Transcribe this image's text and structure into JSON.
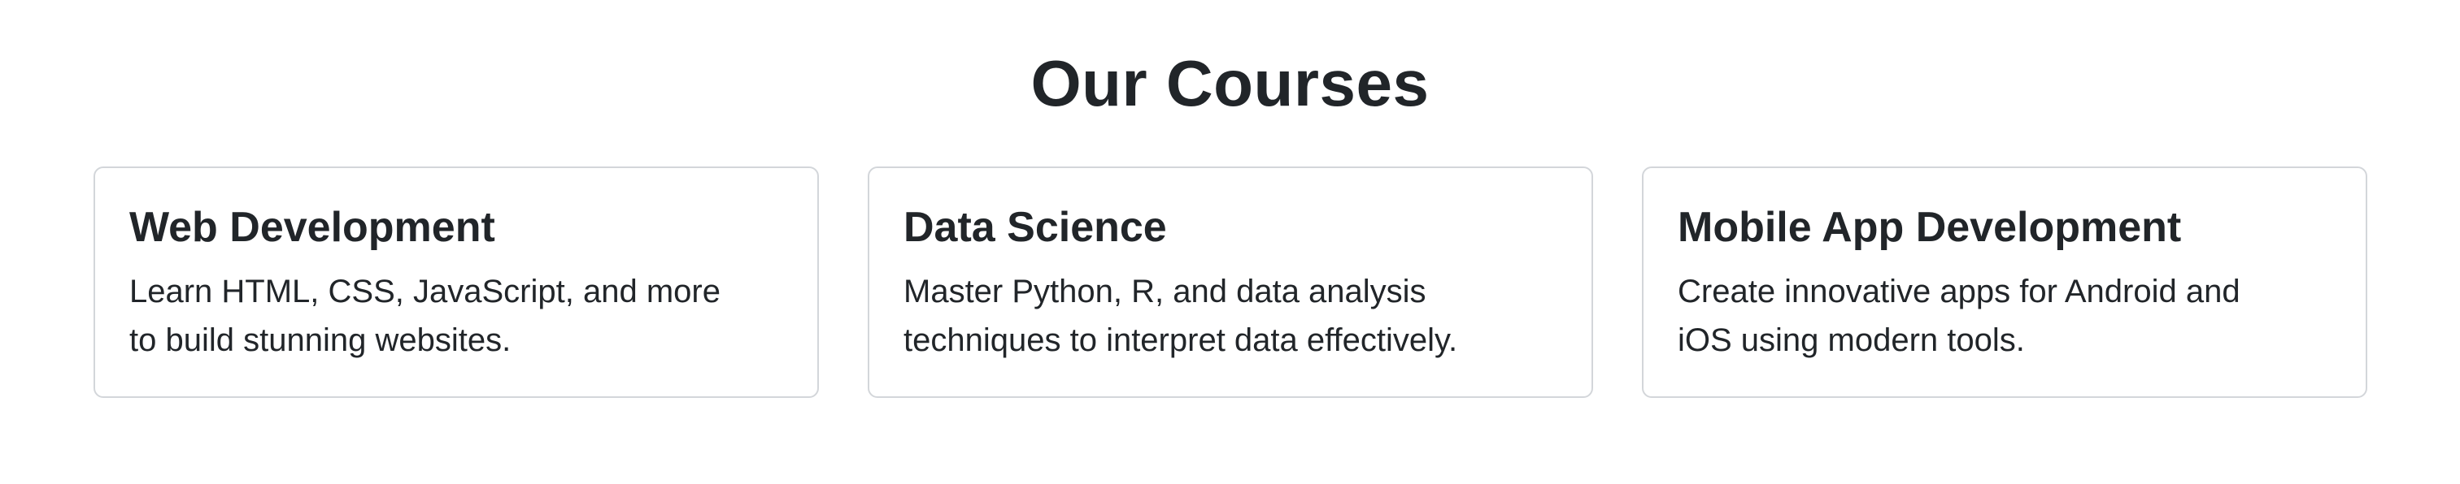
{
  "section": {
    "title": "Our Courses"
  },
  "courses": [
    {
      "title": "Web Development",
      "description": "Learn HTML, CSS, JavaScript, and more to build stunning websites."
    },
    {
      "title": "Data Science",
      "description": "Master Python, R, and data analysis techniques to interpret data effectively."
    },
    {
      "title": "Mobile App Development",
      "description": "Create innovative apps for Android and iOS using modern tools."
    }
  ]
}
